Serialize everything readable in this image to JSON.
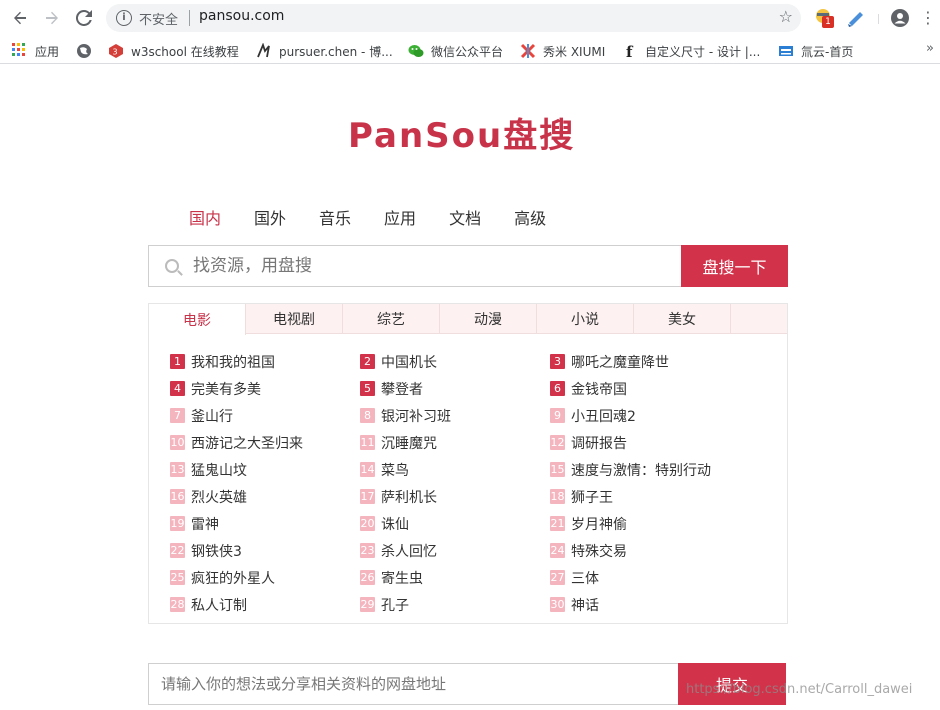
{
  "browser": {
    "insecure_label": "不安全",
    "url": "pansou.com"
  },
  "bookmarks": [
    {
      "label": "应用",
      "icon": "apps-grid-icon"
    },
    {
      "label": "",
      "icon": "globe-icon"
    },
    {
      "label": "w3school 在线教程",
      "icon": "w3school-icon"
    },
    {
      "label": "pursuer.chen - 博...",
      "icon": "pursuer-icon"
    },
    {
      "label": "微信公众平台",
      "icon": "wechat-icon"
    },
    {
      "label": "秀米 XIUMI",
      "icon": "xiumi-icon"
    },
    {
      "label": "自定义尺寸 - 设计 |...",
      "icon": "f-letter-icon"
    },
    {
      "label": "氚云-首页",
      "icon": "h3yun-icon"
    }
  ],
  "logo": "PanSou盘搜",
  "category_tabs": [
    "国内",
    "国外",
    "音乐",
    "应用",
    "文档",
    "高级"
  ],
  "search": {
    "placeholder": "找资源，用盘搜",
    "button_label": "盘搜一下"
  },
  "rank_tabs": [
    "电影",
    "电视剧",
    "综艺",
    "动漫",
    "小说",
    "美女"
  ],
  "rank_items": [
    "我和我的祖国",
    "中国机长",
    "哪吒之魔童降世",
    "完美有多美",
    "攀登者",
    "金钱帝国",
    "釜山行",
    "银河补习班",
    "小丑回魂2",
    "西游记之大圣归来",
    "沉睡魔咒",
    "调研报告",
    "猛鬼山坟",
    "菜鸟",
    "速度与激情：特别行动",
    "烈火英雄",
    "萨利机长",
    "狮子王",
    "雷神",
    "诛仙",
    "岁月神偷",
    "钢铁侠3",
    "杀人回忆",
    "特殊交易",
    "疯狂的外星人",
    "寄生虫",
    "三体",
    "私人订制",
    "孔子",
    "神话"
  ],
  "feedback": {
    "placeholder": "请输入你的想法或分享相关资料的网盘地址",
    "button_label": "提交"
  },
  "watermark": "https://blog.csdn.net/Carroll_dawei",
  "colors": {
    "brand": "#d2334a",
    "rank_top": "#d2334a",
    "rank_other": "#f5b5bf"
  }
}
